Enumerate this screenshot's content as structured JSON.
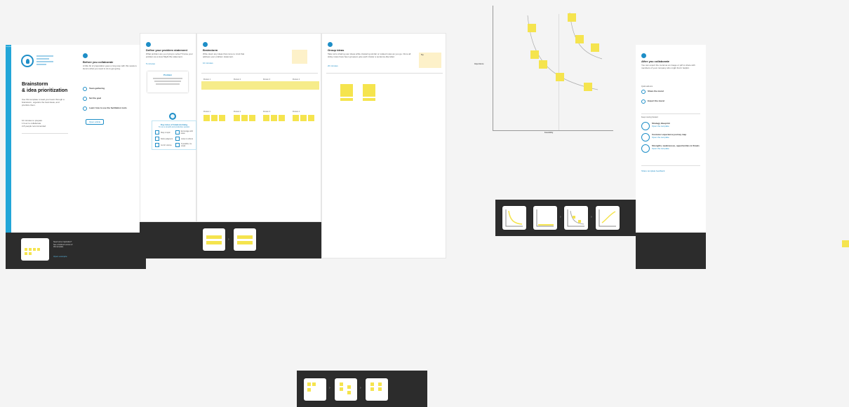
{
  "intro": {
    "tag": "Template",
    "title_line1": "Brainstorm",
    "title_line2": "& idea prioritization",
    "description": "Use this template to lead your team through a brainstorm, organize the best ideas, and prioritize them.",
    "meta": [
      "10 minutes to prepare",
      "1 hour to collaborate",
      "2-8 people recommended"
    ],
    "footer_text": "Need some inspiration? See a finished version of this template.",
    "footer_link": "Open example"
  },
  "step_before": {
    "number": "1",
    "title": "Before you collaborate",
    "text": "A little bit of preparation goes a long way with this session. Here's what you need to do to get going.",
    "items": [
      "Team gathering",
      "Set the goal",
      "Learn how to use the facilitation tools"
    ],
    "button": "Open article"
  },
  "step_define": {
    "number": "2",
    "title": "Define your problem statement",
    "text": "What problem are you trying to solve? Frame your problem as a How Might We statement.",
    "link": "5 minutes",
    "card_title": "Problem",
    "hmw_title": "Key rules of brainstorming",
    "hmw_sub": "To run a smooth and productive session",
    "rules": [
      "Stay in topic",
      "Encourage wild ideas",
      "Defer judgment",
      "Listen to others",
      "Go for volume",
      "If possible, be visual"
    ]
  },
  "step_brainstorm": {
    "number": "3",
    "title": "Brainstorm",
    "text": "Write down any ideas that come to mind that address your problem statement.",
    "link": "10 minutes",
    "people": [
      "Person 1",
      "Person 2",
      "Person 3",
      "Person 4"
    ]
  },
  "step_group": {
    "number": "4",
    "title": "Group ideas",
    "text": "Take turns sharing your ideas while clustering similar or related notes as you go. Once all sticky notes have been grouped, give each cluster a sentence-like label.",
    "link": "20 minutes",
    "tip_title": "Tip"
  },
  "chart": {
    "ylabel": "Importance",
    "xlabel": "Feasibility"
  },
  "after": {
    "number": "6",
    "title": "After you collaborate",
    "text": "You can export the mural as an image or pdf to share with members of your company who might find it helpful.",
    "section1": "Quick add-ons",
    "share_items": [
      "Share the mural",
      "Export the mural"
    ],
    "section2": "Keep moving forward",
    "steps": [
      "Strategy blueprint",
      "Customer experience journey map",
      "Strengths, weaknesses, opportunities & threats"
    ],
    "step_links": [
      "Open the template",
      "Open the template",
      "Open the template"
    ],
    "share_link": "Share template feedback"
  }
}
